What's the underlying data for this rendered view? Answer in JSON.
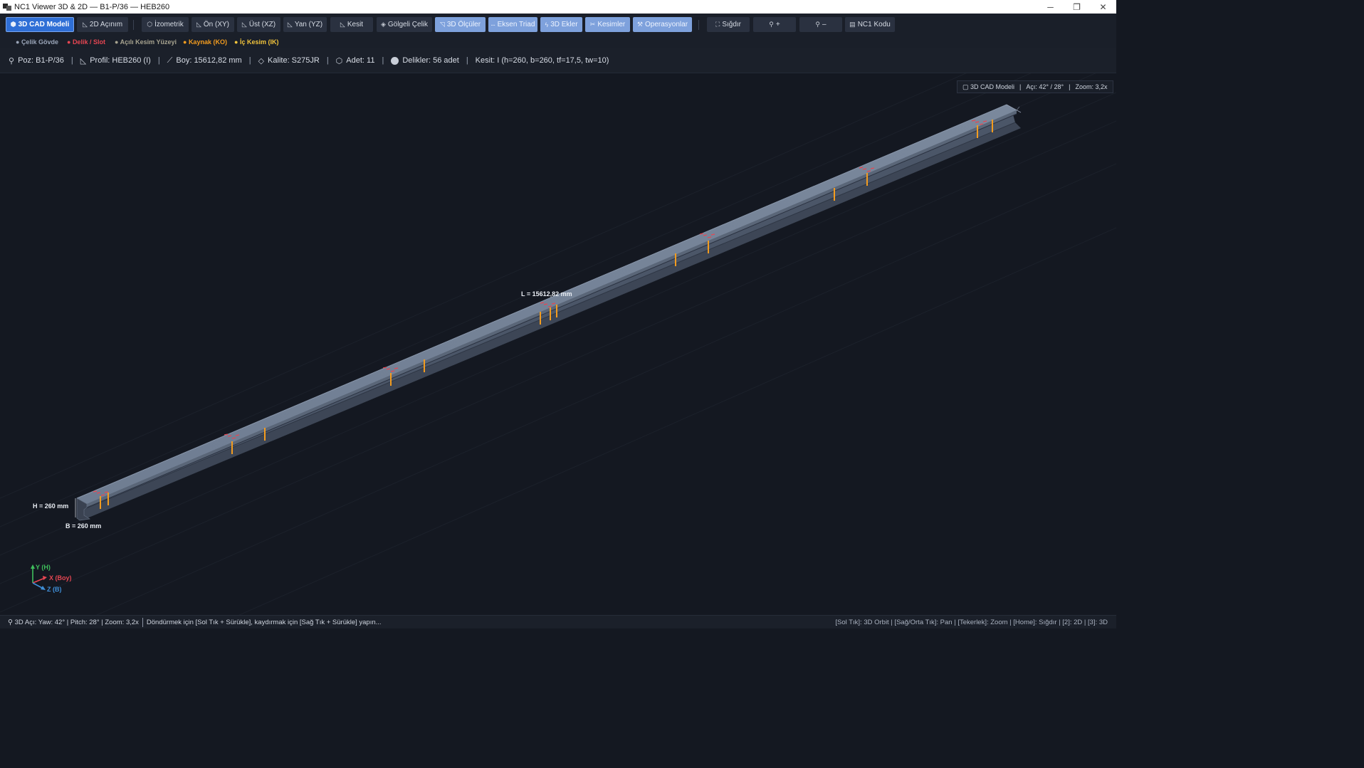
{
  "window": {
    "title": "NC1 Viewer 3D & 2D — B1-P/36 — HEB260",
    "minimize": "─",
    "restore": "❐",
    "close": "✕"
  },
  "toolbar": {
    "buttons": [
      {
        "id": "3d-cad",
        "label": "3D CAD Modeli",
        "icon": "cube-icon",
        "glyph": "⬢"
      },
      {
        "id": "2d-acinim",
        "label": "2D Açınım",
        "icon": "ruler-icon",
        "glyph": "📐"
      },
      {
        "id": "izometrik",
        "label": "İzometrik",
        "icon": "cube-icon",
        "glyph": "⬡"
      },
      {
        "id": "on-xy",
        "label": "Ön (XY)",
        "icon": "ruler-icon",
        "glyph": "📐"
      },
      {
        "id": "ust-xz",
        "label": "Üst (XZ)",
        "icon": "ruler-icon",
        "glyph": "📐"
      },
      {
        "id": "yan-yz",
        "label": "Yan (YZ)",
        "icon": "ruler-icon",
        "glyph": "📐"
      },
      {
        "id": "kesit",
        "label": "Kesit",
        "icon": "ruler-icon",
        "glyph": "📐"
      },
      {
        "id": "golgeli-celik",
        "label": "Gölgeli Çelik",
        "icon": "paint-icon",
        "glyph": "◈"
      },
      {
        "id": "3d-olculer",
        "label": "3D Ölçüler",
        "icon": "ruler-icon",
        "glyph": "📏"
      },
      {
        "id": "eksen-triad",
        "label": "Eksen Triad",
        "icon": "axis-icon",
        "glyph": "—"
      },
      {
        "id": "3d-ekler",
        "label": "3D Ekler",
        "icon": "bolt-icon",
        "glyph": "⚡"
      },
      {
        "id": "kesimler",
        "label": "Kesimler",
        "icon": "scissors-icon",
        "glyph": "✂"
      },
      {
        "id": "operasyonlar",
        "label": "Operasyonlar",
        "icon": "wrench-icon",
        "glyph": "🔧"
      },
      {
        "id": "sigdir",
        "label": "Sığdır",
        "icon": "fit-icon",
        "glyph": "⛶"
      },
      {
        "id": "zoom-in",
        "label": "+",
        "icon": "magnifier-icon",
        "glyph": "🔍"
      },
      {
        "id": "zoom-out",
        "label": "–",
        "icon": "magnifier-icon",
        "glyph": "🔍"
      },
      {
        "id": "nc1-kodu",
        "label": "NC1 Kodu",
        "icon": "document-icon",
        "glyph": "📄"
      }
    ]
  },
  "legend": [
    {
      "label": "Çelik Gövde",
      "color": "#9aa5b8"
    },
    {
      "label": "Delik / Slot",
      "color": "#e64652"
    },
    {
      "label": "Açılı Kesim Yüzeyi",
      "color": "#a7a38f"
    },
    {
      "label": "Kaynak (KO)",
      "color": "#f39c1f"
    },
    {
      "label": "İç Kesim (IK)",
      "color": "#f2c43c"
    }
  ],
  "info": {
    "poz": "Poz: B1-P/36",
    "profil": "Profil: HEB260 (I)",
    "boy": "Boy: 15612,82 mm",
    "kalite": "Kalite: S275JR",
    "adet": "Adet: 11",
    "delikler": "Delikler: 56 adet",
    "kesit": "Kesit: I (h=260, b=260, tf=17,5, tw=10)"
  },
  "viewport": {
    "badge_mode": "3D CAD Modeli",
    "badge_angle": "Açı: 42° / 28°",
    "badge_zoom": "Zoom: 3,2x",
    "label_length": "L = 15612,82 mm",
    "label_height": "H = 260 mm",
    "label_width": "B = 260 mm",
    "axis_y": "Y (H)",
    "axis_x": "X (Boy)",
    "axis_z": "Z (B)",
    "colors": {
      "beam_top": "#6a788d",
      "beam_side": "#4d596a",
      "hole": "#e64652",
      "weld": "#f39c1f"
    }
  },
  "status": {
    "left": "3D Açı: Yaw: 42° | Pitch: 28° | Zoom: 3,2x",
    "hint": "Döndürmek için [Sol Tık + Sürükle], kaydırmak için [Sağ Tık + Sürükle] yapın...",
    "right": "[Sol Tık]: 3D Orbit  |  [Sağ/Orta Tık]: Pan  |  [Tekerlek]: Zoom  |  [Home]: Sığdır  |  [2]: 2D  |  [3]: 3D"
  }
}
